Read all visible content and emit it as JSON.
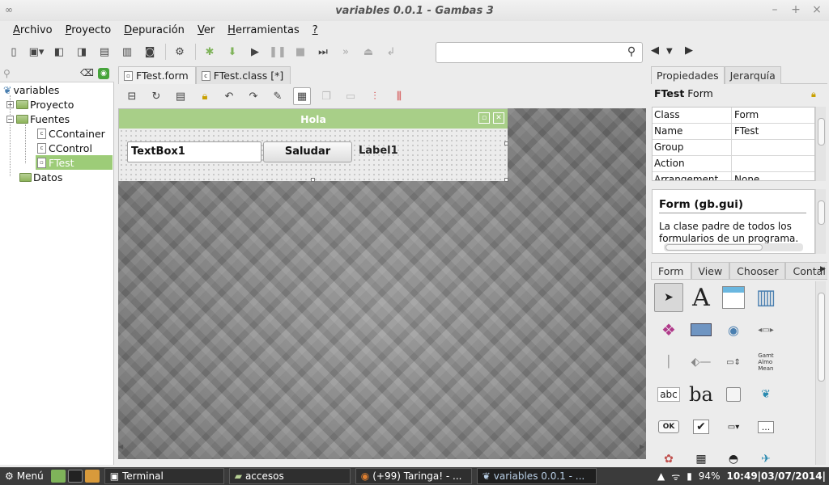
{
  "window": {
    "title": "variables 0.0.1 - Gambas 3",
    "controls": [
      "–",
      "+",
      "×"
    ]
  },
  "menu": [
    {
      "label": "Archivo",
      "mnemonic": "A",
      "rest": "rchivo"
    },
    {
      "label": "Proyecto",
      "mnemonic": "P",
      "rest": "royecto"
    },
    {
      "label": "Depuración",
      "mnemonic": "D",
      "rest": "epuración"
    },
    {
      "label": "Ver",
      "mnemonic": "V",
      "rest": "er"
    },
    {
      "label": "Herramientas",
      "mnemonic": "H",
      "rest": "erramientas"
    },
    {
      "label": "?",
      "mnemonic": "?",
      "rest": ""
    }
  ],
  "search": {
    "placeholder": "",
    "value": ""
  },
  "project_tree": {
    "root": "variables",
    "items": [
      {
        "label": "Proyecto",
        "type": "folder",
        "expander": "+"
      },
      {
        "label": "Fuentes",
        "type": "folder",
        "expander": "−"
      },
      {
        "label": "CContainer",
        "type": "class"
      },
      {
        "label": "CControl",
        "type": "class"
      },
      {
        "label": "FTest",
        "type": "form",
        "selected": true
      },
      {
        "label": "Datos",
        "type": "folder"
      }
    ]
  },
  "editor": {
    "tabs": [
      {
        "label": "FTest.form",
        "active": true
      },
      {
        "label": "FTest.class [*]",
        "active": false
      }
    ],
    "form": {
      "title": "Hola",
      "textbox": "TextBox1",
      "button": "Saludar",
      "label": "Label1"
    }
  },
  "properties": {
    "tabs": [
      "Propiedades",
      "Jerarquía"
    ],
    "object_name": "FTest",
    "object_class": "Form",
    "rows": [
      {
        "name": "Class",
        "value": "Form"
      },
      {
        "name": "Name",
        "value": "FTest"
      },
      {
        "name": "Group",
        "value": ""
      },
      {
        "name": "Action",
        "value": ""
      },
      {
        "name": "Arrangement",
        "value": "None"
      }
    ],
    "help_title": "Form (gb.gui)",
    "help_text": "La clase padre de todos los formularios de un programa."
  },
  "toolbox": {
    "tabs": [
      "Form",
      "View",
      "Chooser",
      "Contai"
    ],
    "tools": [
      "pointer-icon",
      "label-tool-icon",
      "textarea-tool-icon",
      "movie-tool-icon",
      "picturebox-tool-icon",
      "panel-tool-icon",
      "radio-tool-icon",
      "scrollbar-tool-icon",
      "separator-tool-icon",
      "slider-tool-icon",
      "spinbox-tool-icon",
      "listbox-tool-icon",
      "textlabel-tool-icon",
      "textbox-tool-icon",
      "frame-tool-icon",
      "drawingarea-tool-icon",
      "button-tool-icon",
      "checkbox-tool-icon",
      "combobox-tool-icon",
      "dialog-tool-icon",
      "palette-tool-icon",
      "calendar-tool-icon",
      "mask-tool-icon",
      "embedder-tool-icon"
    ],
    "tool_texts": {
      "label": "A",
      "gamut": "Gamt\nAlmo\nMean",
      "abc": "abc",
      "ba": "ba",
      "ok": "OK",
      "check": "✔",
      "dots": "..."
    }
  },
  "taskbar": {
    "menu_label": "Menú",
    "items": [
      {
        "label": "Terminal",
        "active": false
      },
      {
        "label": "accesos",
        "active": false
      },
      {
        "label": "(+99) Taringa! - ...",
        "active": false
      },
      {
        "label": "variables 0.0.1 - ...",
        "active": true
      }
    ],
    "battery": "94%",
    "clock": "10:49|03/07/2014|"
  },
  "colors": {
    "accent_green": "#9dcc78",
    "form_title": "#a8cf88",
    "taskbar": "#3b3b3b"
  }
}
